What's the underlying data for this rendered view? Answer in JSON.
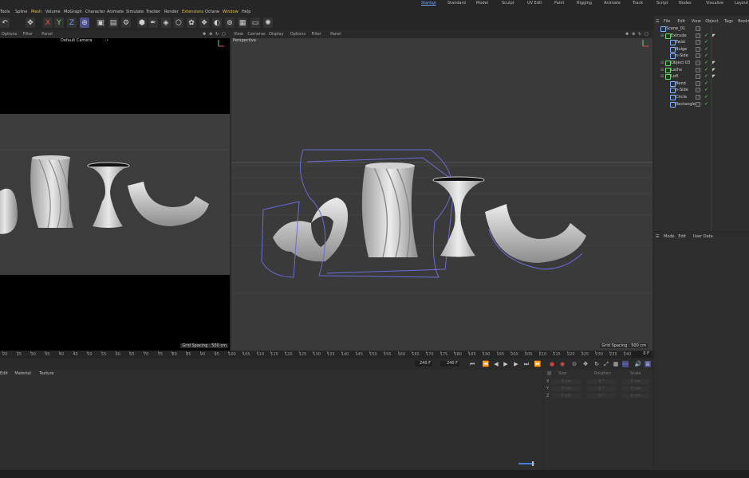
{
  "menubar": {
    "items": [
      "Tools",
      "Spline",
      "Mesh",
      "Volume",
      "MoGraph",
      "Character",
      "Animate",
      "Simulate",
      "Tracker",
      "Render",
      "Extensions",
      "Octane",
      "Window",
      "Help"
    ],
    "highlight_color": "#e2c04a"
  },
  "layouts": {
    "items": [
      "Startup",
      "Standard",
      "Model",
      "Sculpt",
      "UV Edit",
      "Paint",
      "Rigging",
      "Animate",
      "Track",
      "Script",
      "Nodes",
      "Visualize",
      "Layout"
    ],
    "active": "Startup"
  },
  "toolbar": {
    "icons": [
      "undo-icon",
      "move-icon",
      "axis-x-icon",
      "axis-y-icon",
      "axis-z-icon",
      "coordinate-system-icon",
      "render-view-icon",
      "render-picture-viewer-icon",
      "render-settings-icon",
      "cube-icon",
      "spline-pen-icon",
      "subdivision-icon",
      "extrude-generator-icon",
      "cloner-icon",
      "mograph-icon",
      "deformer-icon",
      "field-icon",
      "scene-icon",
      "camera-icon",
      "light-icon"
    ],
    "axis_x": "X",
    "axis_y": "Y",
    "axis_z": "Z"
  },
  "viewport_left": {
    "menu": [
      "Options",
      "Filter",
      "Panel"
    ],
    "camera_label": "Default Camera",
    "camera_suffix": "·:•",
    "grid_spacing": "Grid Spacing : 500 cm"
  },
  "viewport_right": {
    "menu": [
      "View",
      "Cameras",
      "Display",
      "Options",
      "Filter",
      "Panel"
    ],
    "camera_label": "Perspective",
    "grid_spacing": "Grid Spacing : 500 cm"
  },
  "object_manager": {
    "menu": [
      "File",
      "Edit",
      "View",
      "Object",
      "Tags",
      "Bookmarks"
    ],
    "objects": [
      {
        "name": "Scene_01",
        "indent": 0,
        "color": "#7fb3ff"
      },
      {
        "name": "Extrude",
        "indent": 1,
        "color": "#6bdc6b"
      },
      {
        "name": "Twist",
        "indent": 2,
        "color": "#7fb3ff"
      },
      {
        "name": "Bulge",
        "indent": 2,
        "color": "#7fb3ff"
      },
      {
        "name": "n-Side",
        "indent": 2,
        "color": "#7fb3ff"
      },
      {
        "name": "Object 03",
        "indent": 1,
        "color": "#6bdc6b"
      },
      {
        "name": "Lathe",
        "indent": 1,
        "color": "#6bdc6b"
      },
      {
        "name": "Loft",
        "indent": 1,
        "color": "#6bdc6b"
      },
      {
        "name": "Bend",
        "indent": 2,
        "color": "#7fb3ff"
      },
      {
        "name": "n-Side",
        "indent": 2,
        "color": "#7fb3ff"
      },
      {
        "name": "Circle",
        "indent": 2,
        "color": "#7fb3ff"
      },
      {
        "name": "Rectangle",
        "indent": 2,
        "color": "#7fb3ff"
      }
    ]
  },
  "attribute_manager": {
    "menu": [
      "Mode",
      "Edit",
      "User Data"
    ]
  },
  "timeline": {
    "ticks": [
      "20",
      "25",
      "30",
      "35",
      "40",
      "45",
      "50",
      "55",
      "60",
      "65",
      "70",
      "75",
      "80",
      "85",
      "90",
      "95",
      "100",
      "105",
      "110",
      "115",
      "120",
      "125",
      "130",
      "135",
      "140",
      "145",
      "150",
      "155",
      "160",
      "165",
      "170",
      "175",
      "180",
      "185",
      "190",
      "195",
      "200",
      "205",
      "210",
      "215",
      "220",
      "225",
      "230",
      "235",
      "240"
    ],
    "current_frame": "0 F"
  },
  "transport": {
    "start_field": "240 F",
    "end_field": "240 F"
  },
  "material_manager": {
    "menu": [
      "Edit",
      "Material",
      "Texture"
    ]
  },
  "coordinates": {
    "headers": [
      "Size",
      "Rotation",
      "Scale"
    ],
    "rows": [
      {
        "axis": "X",
        "pos": "0 cm",
        "rot": "0 °",
        "scale": "0 cm"
      },
      {
        "axis": "Y",
        "pos": "0 cm",
        "rot": "0 °",
        "scale": "0 cm"
      },
      {
        "axis": "Z",
        "pos": "0 cm",
        "rot": "0 °",
        "scale": "0 cm"
      }
    ]
  }
}
